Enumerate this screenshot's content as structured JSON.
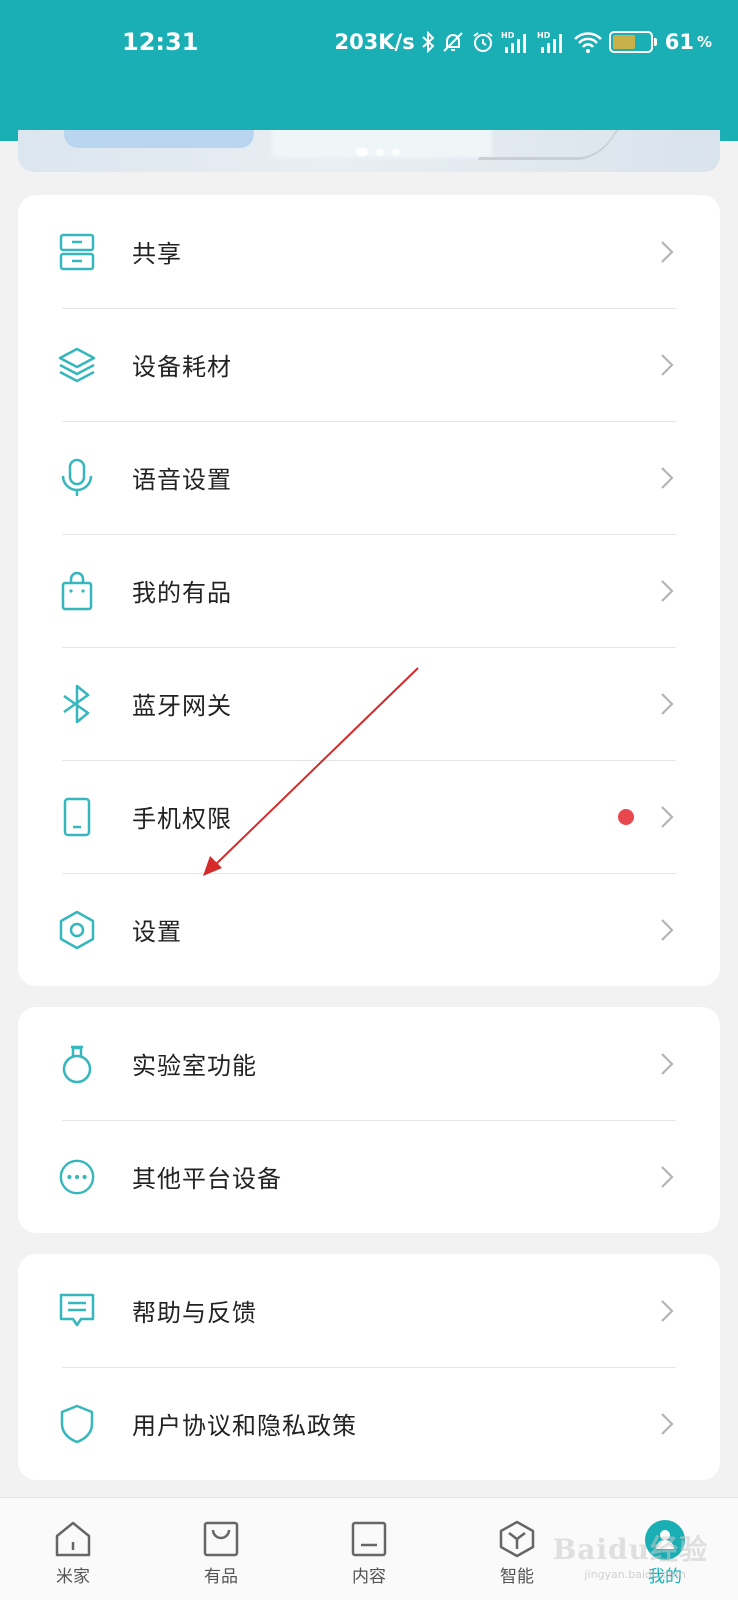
{
  "status_bar": {
    "time": "12:31",
    "speed": "203K/s",
    "battery_percent": "61",
    "battery_sign": "%",
    "icons": [
      "bluetooth-icon",
      "mute-bell-icon",
      "alarm-icon",
      "hd-signal-icon",
      "hd-signal-icon",
      "wifi-icon",
      "battery-icon"
    ]
  },
  "banner": {
    "page_count": 3,
    "active_page": 0
  },
  "menu_group_1": [
    {
      "label": "共享",
      "icon": "share-drawer-icon"
    },
    {
      "label": "设备耗材",
      "icon": "layers-icon"
    },
    {
      "label": "语音设置",
      "icon": "microphone-icon"
    },
    {
      "label": "我的有品",
      "icon": "shopping-bag-icon"
    },
    {
      "label": "蓝牙网关",
      "icon": "bluetooth-icon"
    },
    {
      "label": "手机权限",
      "icon": "phone-icon",
      "badge": true
    },
    {
      "label": "设置",
      "icon": "hexagon-settings-icon"
    }
  ],
  "menu_group_2": [
    {
      "label": "实验室功能",
      "icon": "flask-icon"
    },
    {
      "label": "其他平台设备",
      "icon": "more-dots-icon"
    }
  ],
  "menu_group_3": [
    {
      "label": "帮助与反馈",
      "icon": "feedback-icon"
    },
    {
      "label": "用户协议和隐私政策",
      "icon": "shield-icon"
    }
  ],
  "tab_bar": [
    {
      "label": "米家",
      "icon": "home-icon"
    },
    {
      "label": "有品",
      "icon": "bag-icon"
    },
    {
      "label": "内容",
      "icon": "content-icon"
    },
    {
      "label": "智能",
      "icon": "cube-icon"
    },
    {
      "label": "我的",
      "icon": "profile-icon",
      "active": true
    }
  ],
  "colors": {
    "accent": "#1aafb4",
    "badge": "#e8474d",
    "annotation_arrow": "#d42a2a"
  },
  "watermark": {
    "text": "Baidu经验",
    "sub": "jingyan.baidu.com"
  }
}
